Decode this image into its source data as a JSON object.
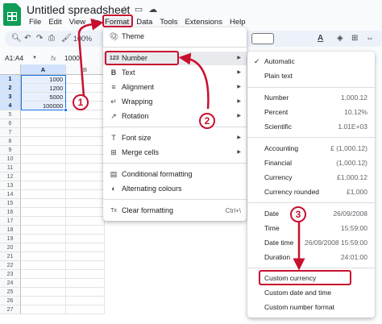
{
  "app": {
    "title": "Untitled spreadsheet",
    "menus": [
      "File",
      "Edit",
      "View",
      "Insert",
      "Format",
      "Data",
      "Tools",
      "Extensions",
      "Help"
    ],
    "active_menu_index": 4
  },
  "toolbar": {
    "zoom": "100%",
    "undo_icon": "undo-icon",
    "redo_icon": "redo-icon",
    "print_icon": "print-icon",
    "paint_format_icon": "paint-format-icon",
    "text_color_glyph": "A"
  },
  "formula_bar": {
    "name_box": "A1:A4",
    "fx_label": "fx",
    "value": "1000"
  },
  "sheet": {
    "columns": [
      "A",
      "B"
    ],
    "rows": [
      "1",
      "2",
      "3",
      "4",
      "5",
      "6",
      "7",
      "8",
      "9",
      "10",
      "11",
      "12",
      "13",
      "14",
      "15",
      "16",
      "17",
      "18",
      "19",
      "20",
      "21",
      "22",
      "23",
      "24",
      "25",
      "26",
      "27"
    ],
    "values": [
      "1000",
      "1200",
      "5000",
      "100000"
    ]
  },
  "format_menu": {
    "items": [
      {
        "label": "Theme",
        "icon": "palette-icon",
        "arrow": false
      },
      {
        "label": "Number",
        "icon": "123",
        "arrow": true
      },
      {
        "label": "Text",
        "icon": "B",
        "arrow": true
      },
      {
        "label": "Alignment",
        "icon": "≡",
        "arrow": true
      },
      {
        "label": "Wrapping",
        "icon": "↵",
        "arrow": true
      },
      {
        "label": "Rotation",
        "icon": "↗",
        "arrow": true
      },
      {
        "label": "Font size",
        "icon": "T",
        "arrow": true
      },
      {
        "label": "Merge cells",
        "icon": "⊞",
        "arrow": true
      },
      {
        "label": "Conditional formatting",
        "icon": "▤",
        "arrow": false
      },
      {
        "label": "Alternating colours",
        "icon": "◐",
        "arrow": false
      },
      {
        "label": "Clear formatting",
        "icon": "Tx",
        "shortcut": "Ctrl+\\",
        "arrow": false
      }
    ]
  },
  "number_menu": {
    "items": [
      {
        "label": "Automatic",
        "value": "",
        "checked": true
      },
      {
        "label": "Plain text",
        "value": ""
      },
      {
        "label": "Number",
        "value": "1,000.12"
      },
      {
        "label": "Percent",
        "value": "10.12%"
      },
      {
        "label": "Scientific",
        "value": "1.01E+03"
      },
      {
        "label": "Accounting",
        "value": "£ (1,000.12)"
      },
      {
        "label": "Financial",
        "value": "(1,000.12)"
      },
      {
        "label": "Currency",
        "value": "£1,000.12"
      },
      {
        "label": "Currency rounded",
        "value": "£1,000"
      },
      {
        "label": "Date",
        "value": "26/09/2008"
      },
      {
        "label": "Time",
        "value": "15:59:00"
      },
      {
        "label": "Date time",
        "value": "26/09/2008 15:59:00"
      },
      {
        "label": "Duration",
        "value": "24:01:00"
      },
      {
        "label": "Custom currency",
        "value": ""
      },
      {
        "label": "Custom date and time",
        "value": ""
      },
      {
        "label": "Custom number format",
        "value": ""
      }
    ]
  },
  "annotations": {
    "badges": [
      "1",
      "2",
      "3"
    ],
    "color": "#c8102e"
  }
}
